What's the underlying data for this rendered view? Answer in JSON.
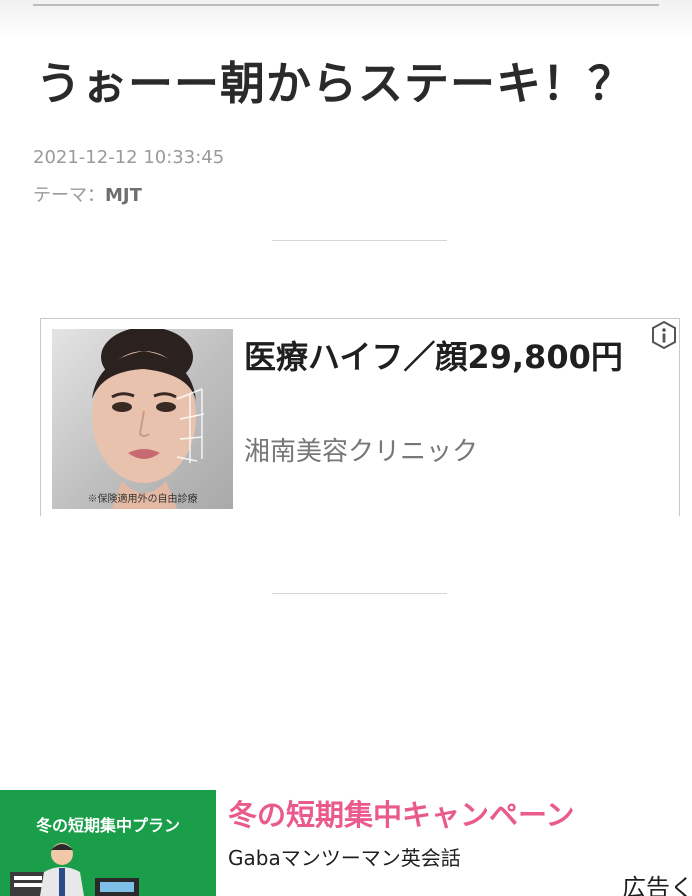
{
  "article": {
    "title": "うぉーー朝からステーキ！？",
    "date": "2021-12-12 10:33:45",
    "theme_label": "テーマ：",
    "theme_name": "MJT"
  },
  "ad1": {
    "headline": "医療ハイフ／顔29,800円",
    "advertiser": "湘南美容クリニック",
    "image_note": "※保険適用外の自由診療"
  },
  "ad2": {
    "image_label": "冬の短期集中プラン",
    "headline": "冬の短期集中キャンペーン",
    "advertiser": "Gabaマンツーマン英会話",
    "badge": "広告く"
  },
  "colors": {
    "ad2_headline": "#ea5a8c",
    "ad2_image_bg": "#1a9e4a"
  }
}
